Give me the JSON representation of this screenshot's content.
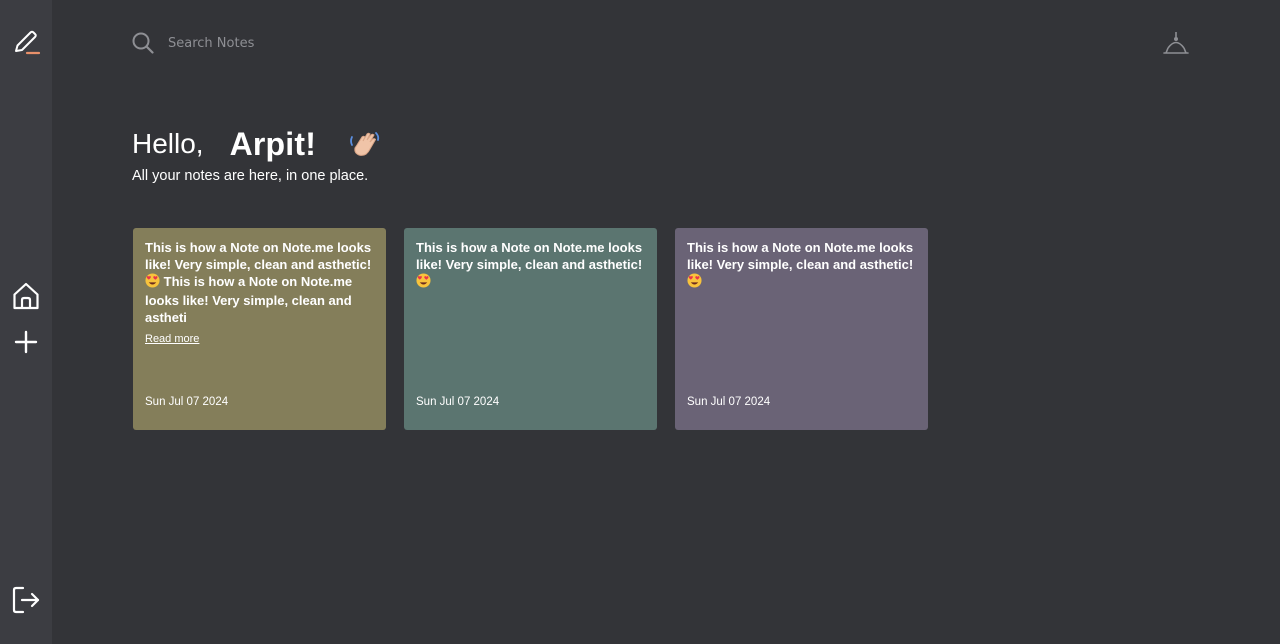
{
  "search": {
    "placeholder": "Search Notes"
  },
  "greeting": {
    "hello": "Hello,",
    "name": "Arpit!",
    "subtitle": "All your notes are here, in one place."
  },
  "notes": [
    {
      "text_a": "This is how a Note on Note.me looks like! Very simple, clean and asthetic!",
      "text_b": "This is how a Note on Note.me looks like! Very simple, clean and astheti",
      "read_more": "Read more",
      "date": "Sun Jul 07 2024",
      "color": "#847e5a"
    },
    {
      "text_a": "This is how a Note on Note.me looks like! Very simple, clean and asthetic!",
      "date": "Sun Jul 07 2024",
      "color": "#5b7570"
    },
    {
      "text_a": "This is how a Note on Note.me looks like! Very simple, clean and asthetic!",
      "date": "Sun Jul 07 2024",
      "color": "#6a6376"
    }
  ],
  "icons": {
    "logo": "pencil-icon",
    "home": "home-icon",
    "add": "plus-icon",
    "logout": "logout-icon",
    "search": "search-icon",
    "top_right": "desk-lamp-icon",
    "wave": "waving-hand-icon",
    "emoji": "heart-eyes-emoji-icon"
  },
  "colors": {
    "background": "#333438",
    "sidebar": "#3c3d42",
    "accent": "#e8906a"
  }
}
